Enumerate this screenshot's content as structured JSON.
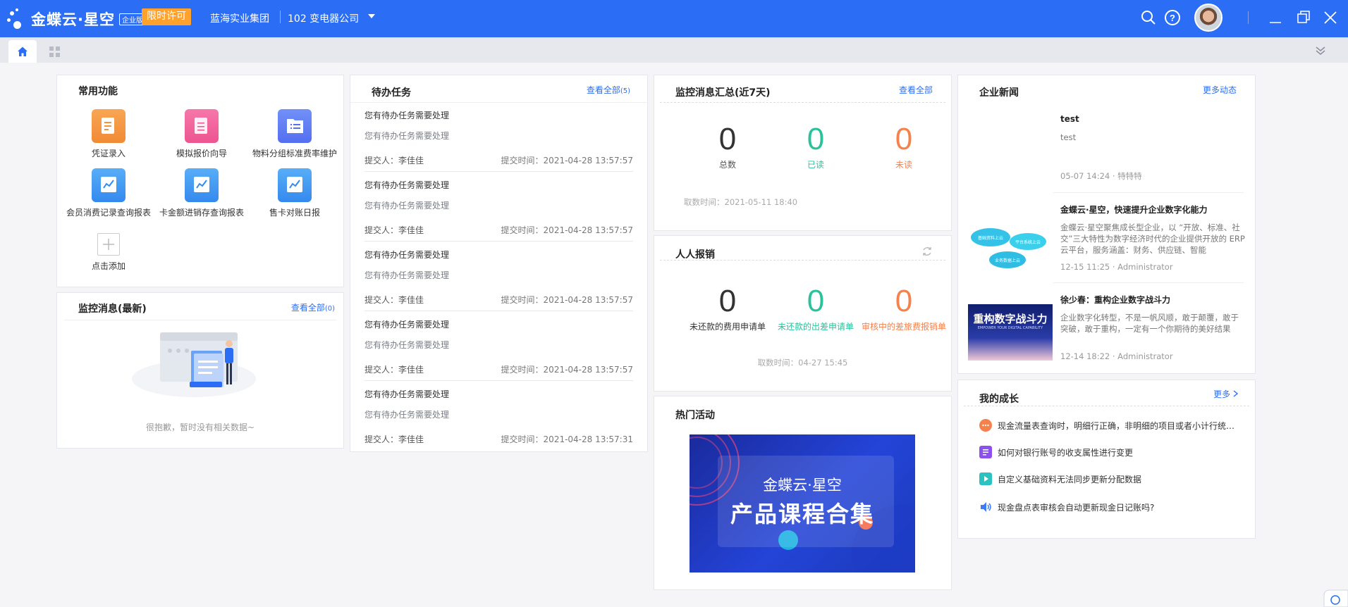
{
  "topbar": {
    "logo_text": "金蝶云·星空",
    "logo_badge": "企业版",
    "license_label": "限时许可",
    "org_name": "蓝海实业集团",
    "company_label": "102  变电器公司"
  },
  "common_functions": {
    "title": "常用功能",
    "items": [
      {
        "label": "凭证录入",
        "color": "#f5933a"
      },
      {
        "label": "模拟报价向导",
        "color": "#f0639a"
      },
      {
        "label": "物料分组标准费率维护",
        "color": "#5d7ef5"
      },
      {
        "label": "会员消费记录查询报表",
        "color": "#3d9af2"
      },
      {
        "label": "卡金额进销存查询报表",
        "color": "#3d9af2"
      },
      {
        "label": "售卡对账日报",
        "color": "#3d9af2"
      },
      {
        "label": "点击添加",
        "color": "#ffffff"
      }
    ]
  },
  "monitor_latest": {
    "title": "监控消息(最新)",
    "link": "查看全部",
    "count": "(0)",
    "empty_text": "很抱歉，暂时没有相关数据~"
  },
  "todo": {
    "title": "待办任务",
    "link": "查看全部",
    "count": "(5)",
    "items": [
      {
        "title": "您有待办任务需要处理",
        "sub": "您有待办任务需要处理",
        "submitter": "提交人：李佳佳",
        "time": "提交时间：2021-04-28 13:57:57"
      },
      {
        "title": "您有待办任务需要处理",
        "sub": "您有待办任务需要处理",
        "submitter": "提交人：李佳佳",
        "time": "提交时间：2021-04-28 13:57:57"
      },
      {
        "title": "您有待办任务需要处理",
        "sub": "您有待办任务需要处理",
        "submitter": "提交人：李佳佳",
        "time": "提交时间：2021-04-28 13:57:57"
      },
      {
        "title": "您有待办任务需要处理",
        "sub": "您有待办任务需要处理",
        "submitter": "提交人：李佳佳",
        "time": "提交时间：2021-04-28 13:57:57"
      },
      {
        "title": "您有待办任务需要处理",
        "sub": "您有待办任务需要处理",
        "submitter": "提交人：李佳佳",
        "time": "提交时间：2021-04-28 13:57:31"
      }
    ]
  },
  "monitor_summary": {
    "title": "监控消息汇总(近7天)",
    "link": "查看全部",
    "stats": [
      {
        "value": "0",
        "label": "总数",
        "color": "#222222"
      },
      {
        "value": "0",
        "label": "已读",
        "color": "#2bc29a"
      },
      {
        "value": "0",
        "label": "未读",
        "color": "#f5814c"
      }
    ],
    "fetch_time": "取数时间：2021-05-11 18:40"
  },
  "expense": {
    "title": "人人报销",
    "stats": [
      {
        "value": "0",
        "label": "未还款的费用申请单",
        "color": "#222222"
      },
      {
        "value": "0",
        "label": "未还款的出差申请单",
        "color": "#2bc29a"
      },
      {
        "value": "0",
        "label": "审核中的差旅费报销单",
        "color": "#f5814c"
      }
    ],
    "fetch_time": "取数时间：04-27 15:45"
  },
  "hot": {
    "title": "热门活动",
    "banner_line1": "金蝶云·星空",
    "banner_line2": "产品课程合集"
  },
  "news": {
    "title": "企业新闻",
    "link": "更多动态",
    "items": [
      {
        "title": "test",
        "desc": "test",
        "meta": "05-07 14:24 · 特特特"
      },
      {
        "title": "金蝶云·星空，快速提升企业数字化能力",
        "desc": "金蝶云·星空聚焦成长型企业，以 “开放、标准、社交”三大特性为数字经济时代的企业提供开放的 ERP 云平台，服务涵盖：财务、供应链、智能",
        "meta": "12-15 11:25 · Administrator"
      },
      {
        "title": "徐少春：重构企业数字战斗力",
        "desc": "企业数字化转型，不是一帆风顺，敢于颠覆，敢于突破，敢于重构，一定有一个你期待的美好结果",
        "meta": "12-14 18:22 · Administrator"
      }
    ],
    "thumb2_text": "重构数字战斗力",
    "thumb2_sub": "EMPOWER YOUR DIGITAL CAPABILITY"
  },
  "growth": {
    "title": "我的成长",
    "link": "更多",
    "items": [
      {
        "text": "现金流量表查询时，明细行正确，非明细的项目或者小计行统…",
        "icon": "chat-icon",
        "color": "#f5814c"
      },
      {
        "text": "如何对银行账号的收支属性进行变更",
        "icon": "doc-icon",
        "color": "#8c4ff0"
      },
      {
        "text": "自定义基础资料无法同步更新分配数据",
        "icon": "video-icon",
        "color": "#2bc2c2"
      },
      {
        "text": "现金盘点表审核会自动更新现金日记账吗?",
        "icon": "audio-icon",
        "color": "#3d7cf5"
      }
    ]
  }
}
